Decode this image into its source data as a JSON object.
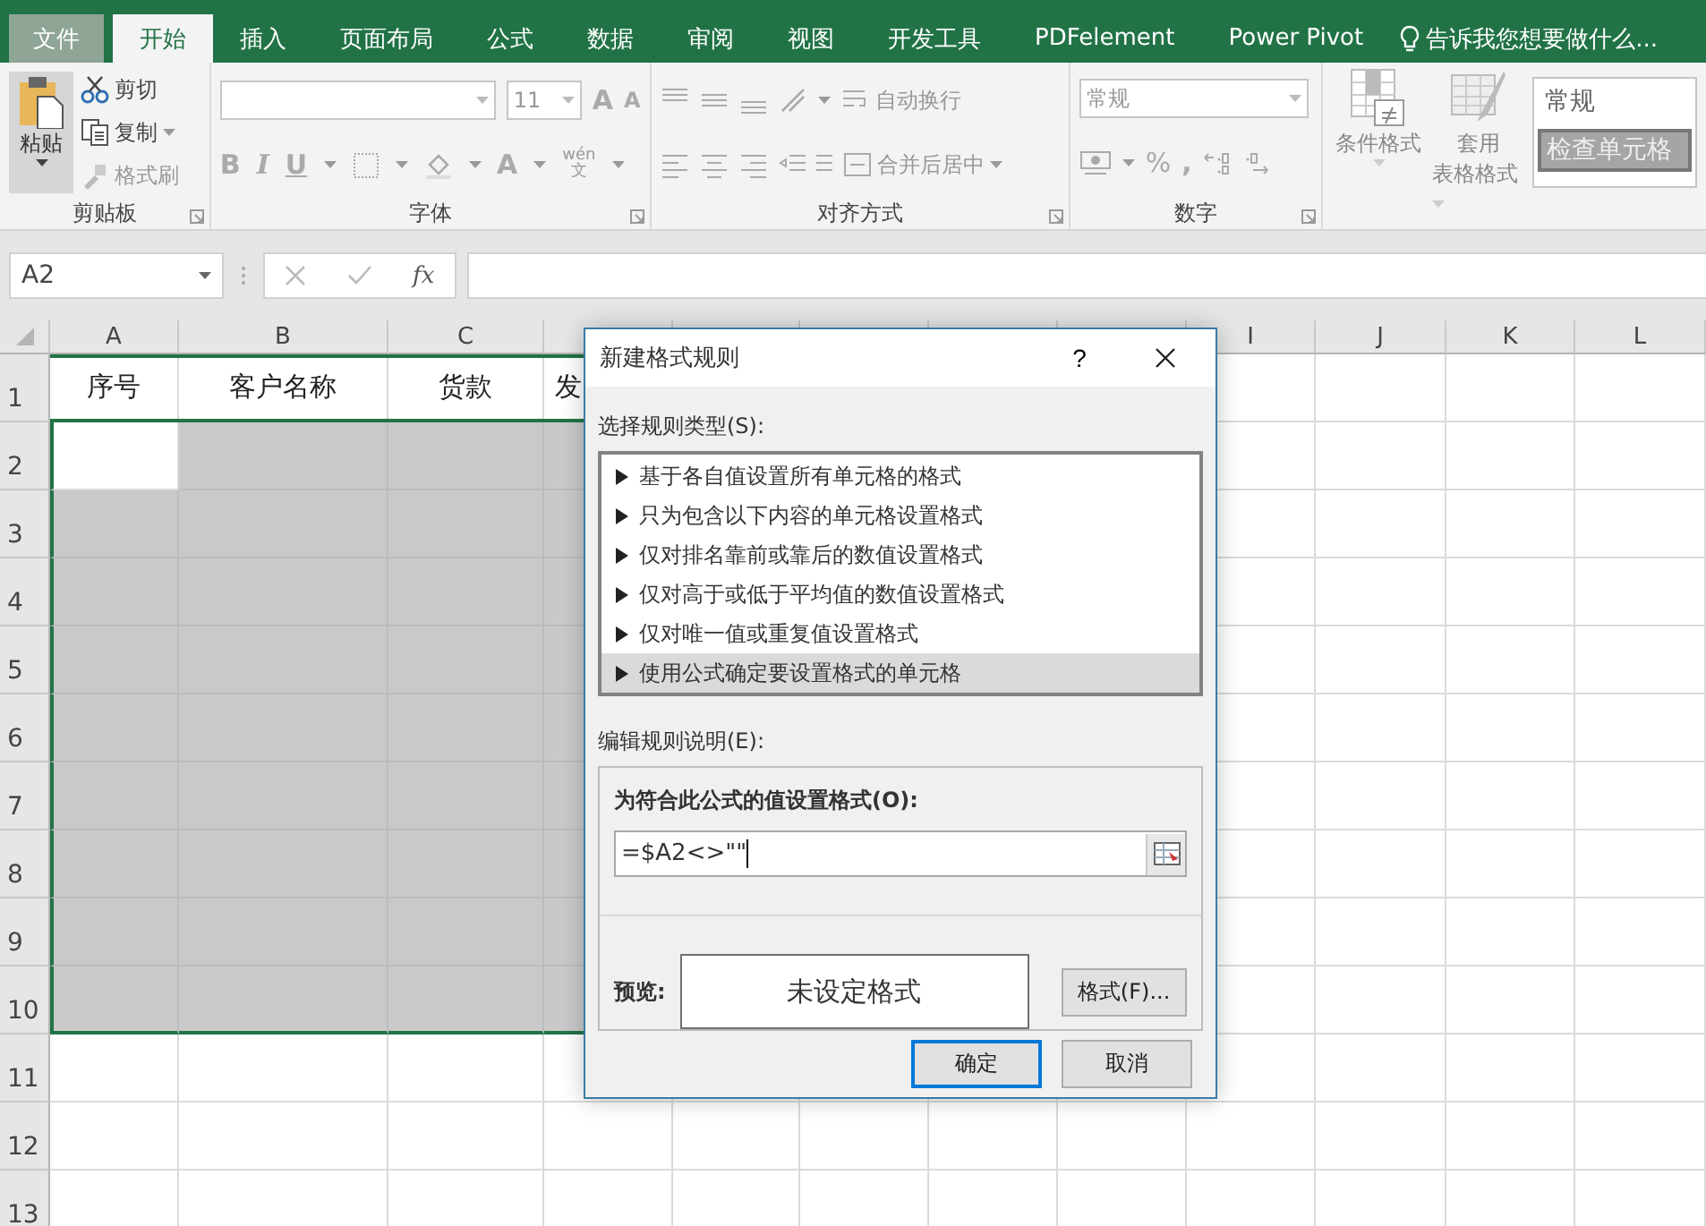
{
  "tabs": [
    {
      "label": "文件",
      "kind": "file",
      "selected": false
    },
    {
      "label": "开始",
      "kind": "tab",
      "selected": true
    },
    {
      "label": "插入",
      "kind": "tab",
      "selected": false
    },
    {
      "label": "页面布局",
      "kind": "tab",
      "selected": false
    },
    {
      "label": "公式",
      "kind": "tab",
      "selected": false
    },
    {
      "label": "数据",
      "kind": "tab",
      "selected": false
    },
    {
      "label": "审阅",
      "kind": "tab",
      "selected": false
    },
    {
      "label": "视图",
      "kind": "tab",
      "selected": false
    },
    {
      "label": "开发工具",
      "kind": "tab",
      "selected": false
    },
    {
      "label": "PDFelement",
      "kind": "tab",
      "selected": false
    },
    {
      "label": "Power Pivot",
      "kind": "tab",
      "selected": false
    }
  ],
  "tell_me": {
    "placeholder": "告诉我您想要做什么..."
  },
  "ribbon": {
    "clipboard": {
      "paste": "粘贴",
      "cut": "剪切",
      "copy": "复制",
      "format_painter": "格式刷",
      "label": "剪贴板"
    },
    "font": {
      "font_size": "11",
      "grow": "A",
      "shrink": "A",
      "bold": "B",
      "italic": "I",
      "underline": "U",
      "font_color": "A",
      "phonetic_top": "wén",
      "phonetic_bottom": "文",
      "label": "字体"
    },
    "alignment": {
      "wrap_text": "自动换行",
      "merge_center": "合并后居中",
      "label": "对齐方式"
    },
    "number": {
      "format": "常规",
      "percent": "%",
      "comma": ",",
      "label": "数字"
    },
    "styles": {
      "conditional_formatting": "条件格式",
      "format_as_table_1": "套用",
      "format_as_table_2": "表格格式",
      "gallery": [
        {
          "label": "常规",
          "kind": "normal"
        },
        {
          "label": "检查单元格",
          "kind": "check"
        }
      ]
    }
  },
  "formula_bar": {
    "name_box": "A2",
    "fx": "fx"
  },
  "sheet": {
    "columns": [
      "A",
      "B",
      "C",
      "",
      "",
      "",
      "",
      "",
      "I",
      "J",
      "K",
      "L"
    ],
    "rows": [
      "1",
      "2",
      "3",
      "4",
      "5",
      "6",
      "7",
      "8",
      "9",
      "10",
      "11",
      "12",
      "13"
    ],
    "header_cells": [
      "序号",
      "客户名称",
      "货款",
      "发"
    ]
  },
  "dialog": {
    "title": "新建格式规则",
    "help": "?",
    "rule_type_label": "选择规则类型(S):",
    "rule_types": [
      {
        "label": "基于各自值设置所有单元格的格式",
        "selected": false
      },
      {
        "label": "只为包含以下内容的单元格设置格式",
        "selected": false
      },
      {
        "label": "仅对排名靠前或靠后的数值设置格式",
        "selected": false
      },
      {
        "label": "仅对高于或低于平均值的数值设置格式",
        "selected": false
      },
      {
        "label": "仅对唯一值或重复值设置格式",
        "selected": false
      },
      {
        "label": "使用公式确定要设置格式的单元格",
        "selected": true
      }
    ],
    "description_label": "编辑规则说明(E):",
    "formula_label": "为符合此公式的值设置格式(O):",
    "formula": "=$A2<>\"\"",
    "preview_label": "预览:",
    "preview": "未设定格式",
    "format_button": "格式(F)...",
    "ok": "确定",
    "cancel": "取消"
  }
}
